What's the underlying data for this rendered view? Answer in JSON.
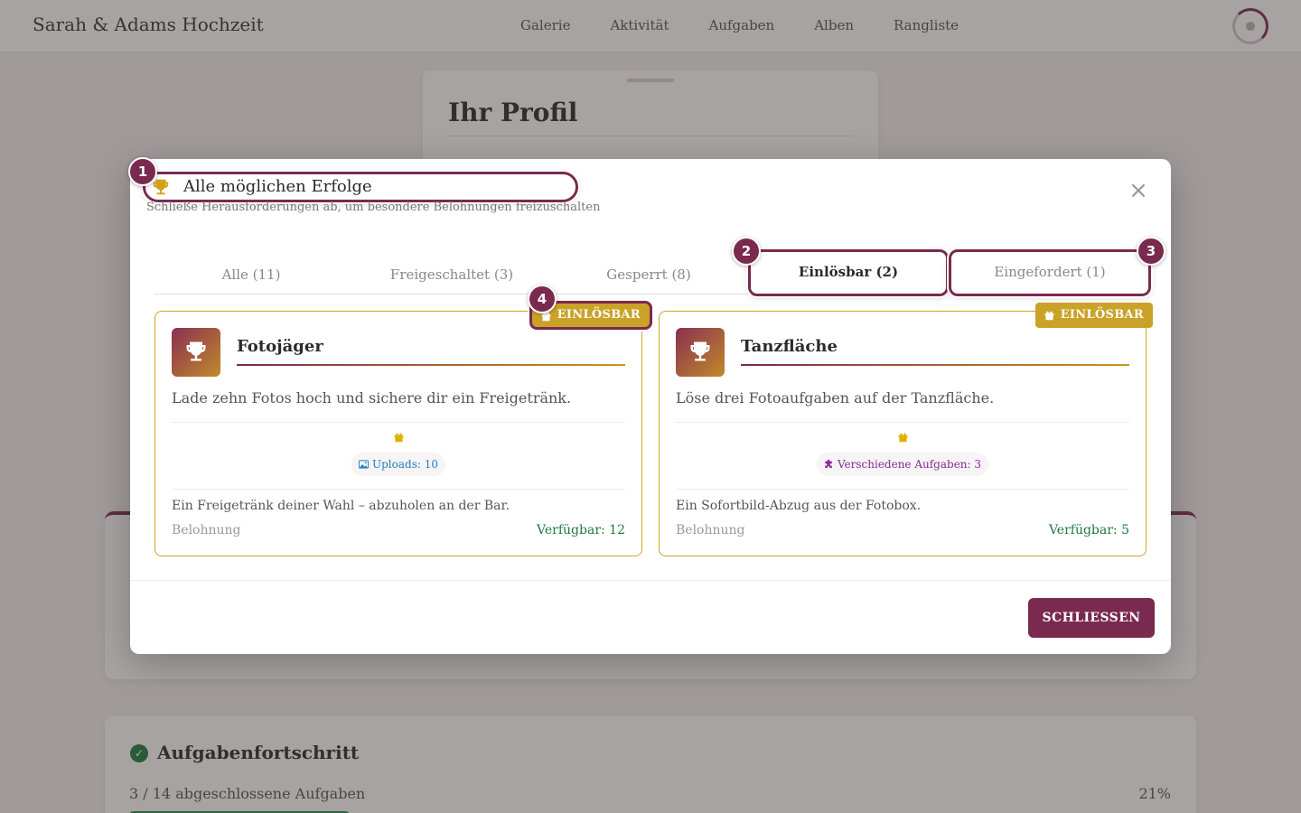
{
  "app": {
    "brand": "Sarah & Adams Hochzeit",
    "nav": [
      "Galerie",
      "Aktivität",
      "Aufgaben",
      "Alben",
      "Rangliste"
    ]
  },
  "background": {
    "profile_title": "Ihr Profil",
    "tasks_title": "Aufgabenfortschritt",
    "tasks_summary": "3 / 14 abgeschlossene Aufgaben",
    "tasks_percent": "21%",
    "tasks_progress": 0.21
  },
  "modal": {
    "title": "Alle möglichen Erfolge",
    "subtitle": "Schließe Herausforderungen ab, um besondere Belohnungen freizuschalten",
    "tabs": [
      {
        "label": "Alle (11)"
      },
      {
        "label": "Freigeschaltet (3)"
      },
      {
        "label": "Gesperrt (8)"
      },
      {
        "label": "Einlösbar (2)"
      },
      {
        "label": "Eingefordert (1)"
      }
    ],
    "active_tab": "Einlösbar (2)",
    "cards": [
      {
        "name": "Fotojäger",
        "description": "Lade zehn Fotos hoch und sichere dir ein Freigetränk.",
        "badge": "EINLÖSBAR",
        "criterion": "Uploads: 10",
        "criterion_icon": "image-icon",
        "reward": "Ein Freigetränk deiner Wahl – abzuholen an der Bar.",
        "reward_label": "Belohnung",
        "available": "Verfügbar: 12"
      },
      {
        "name": "Tanzfläche",
        "description": "Löse drei Fotoaufgaben auf der Tanzfläche.",
        "badge": "EINLÖSBAR",
        "criterion": "Verschiedene Aufgaben: 3",
        "criterion_icon": "puzzle-icon",
        "reward": "Ein Sofortbild-Abzug aus der Fotobox.",
        "reward_label": "Belohnung",
        "available": "Verfügbar: 5"
      }
    ],
    "close_label": "SCHLIESSEN"
  },
  "markers": [
    "1",
    "2",
    "3",
    "4"
  ],
  "colors": {
    "primary": "#7a2a4e",
    "gold": "#c9a227",
    "success": "#1e7a3e"
  }
}
